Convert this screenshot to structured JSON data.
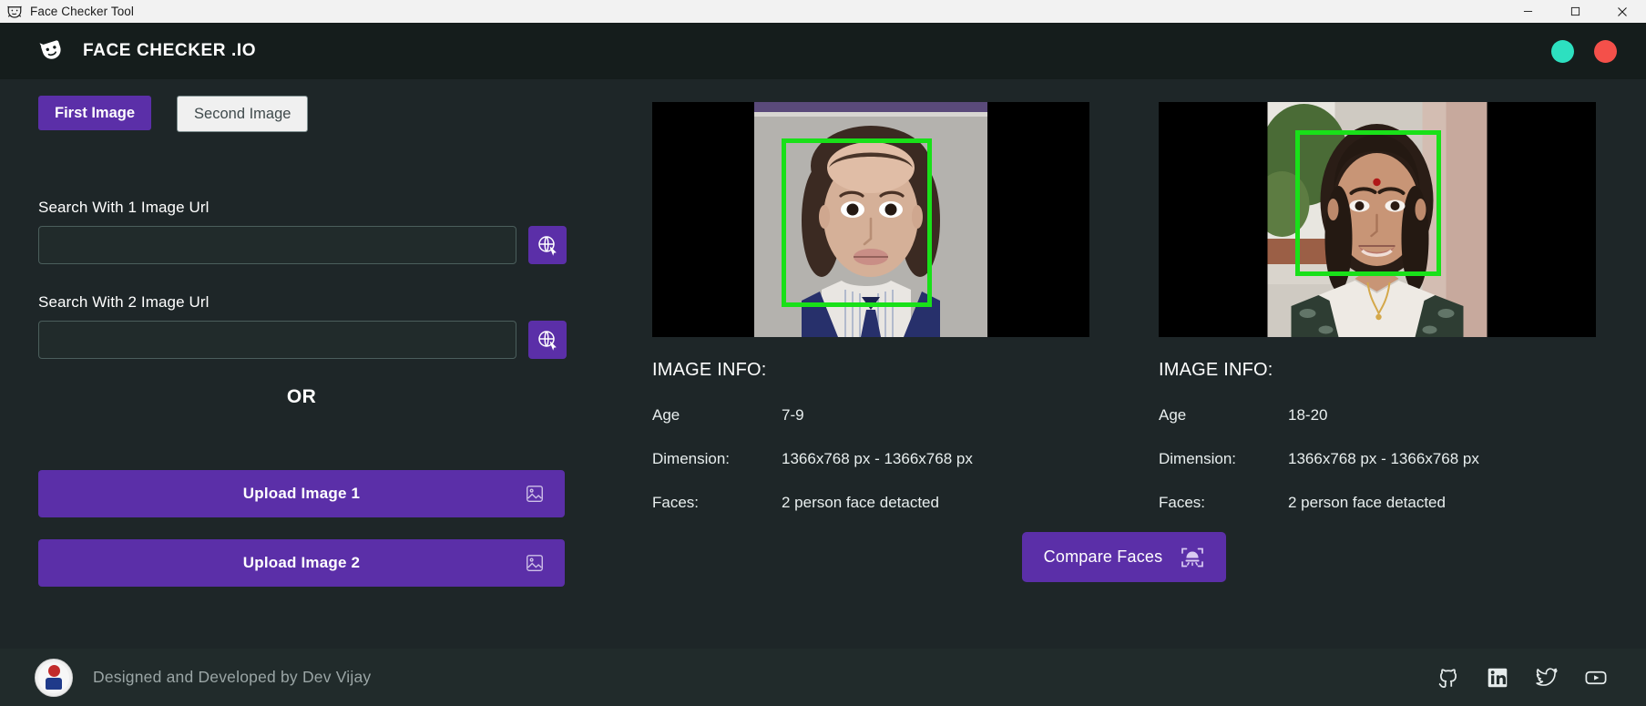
{
  "window": {
    "title": "Face Checker Tool",
    "icon": "app-mask-icon",
    "controls": {
      "minimize": "minimize-icon",
      "maximize": "maximize-icon",
      "close": "close-icon"
    }
  },
  "header": {
    "brand": "FACE CHECKER .IO",
    "logo_icon": "theater-mask-icon",
    "window_dots": [
      {
        "name": "minimize-dot",
        "color": "#2de0c0"
      },
      {
        "name": "close-dot",
        "color": "#f4504a"
      }
    ]
  },
  "sidebar": {
    "tabs": [
      {
        "label": "First Image",
        "active": true
      },
      {
        "label": "Second Image",
        "active": false
      }
    ],
    "url_fields": [
      {
        "label": "Search With 1 Image Url",
        "value": "",
        "placeholder": "",
        "button_icon": "globe-search-icon"
      },
      {
        "label": "Search With 2 Image Url",
        "value": "",
        "placeholder": "",
        "button_icon": "globe-search-icon"
      }
    ],
    "divider_text": "OR",
    "upload_buttons": [
      {
        "label": "Upload Image 1",
        "icon": "image-icon"
      },
      {
        "label": "Upload Image 2",
        "icon": "image-icon"
      }
    ]
  },
  "panels": [
    {
      "name": "first-image-panel",
      "preview_alt": "child portrait photo with green face detection box",
      "info_title": "IMAGE INFO:",
      "rows": [
        {
          "key": "Age",
          "value": "7-9"
        },
        {
          "key": "Dimension:",
          "value": "1366x768 px - 1366x768 px"
        },
        {
          "key": "Faces:",
          "value": "2 person face detacted"
        }
      ]
    },
    {
      "name": "second-image-panel",
      "preview_alt": "young woman portrait photo with green face detection box",
      "info_title": "IMAGE INFO:",
      "rows": [
        {
          "key": "Age",
          "value": "18-20"
        },
        {
          "key": "Dimension:",
          "value": "1366x768 px - 1366x768 px"
        },
        {
          "key": "Faces:",
          "value": "2 person face detacted"
        }
      ]
    }
  ],
  "compare": {
    "label": "Compare Faces",
    "icon": "face-scan-icon"
  },
  "footer": {
    "credit": "Designed and Developed by Dev Vijay",
    "logo_icon": "circular-emblem-logo",
    "socials": [
      {
        "name": "github-icon"
      },
      {
        "name": "linkedin-icon"
      },
      {
        "name": "twitter-icon"
      },
      {
        "name": "youtube-icon"
      }
    ]
  },
  "colors": {
    "accent_purple": "#5b2fa8",
    "face_box_green": "#19e019",
    "header_bg": "#151d1c",
    "body_bg": "#1e2628",
    "footer_bg": "#212b2b"
  }
}
